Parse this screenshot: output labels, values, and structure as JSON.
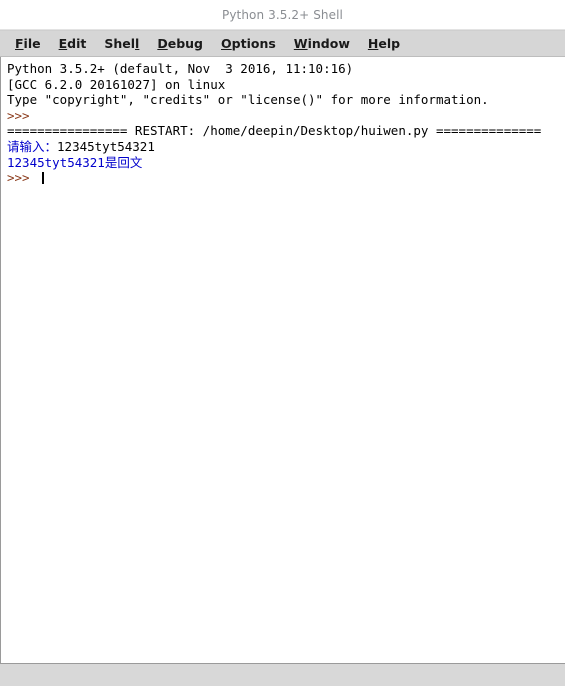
{
  "window": {
    "title": "Python 3.5.2+ Shell"
  },
  "menubar": {
    "items": [
      {
        "name": "file",
        "pre": "",
        "mnemonic": "F",
        "post": "ile"
      },
      {
        "name": "edit",
        "pre": "",
        "mnemonic": "E",
        "post": "dit"
      },
      {
        "name": "shell",
        "pre": "Shel",
        "mnemonic": "l",
        "post": ""
      },
      {
        "name": "debug",
        "pre": "",
        "mnemonic": "D",
        "post": "ebug"
      },
      {
        "name": "options",
        "pre": "",
        "mnemonic": "O",
        "post": "ptions"
      },
      {
        "name": "window",
        "pre": "",
        "mnemonic": "W",
        "post": "indow"
      },
      {
        "name": "help",
        "pre": "",
        "mnemonic": "H",
        "post": "elp"
      }
    ],
    "labels": {
      "file": "File",
      "edit": "Edit",
      "shell": "Shell",
      "debug": "Debug",
      "options": "Options",
      "window": "Window",
      "help": "Help"
    }
  },
  "shell": {
    "banner_line_1": "Python 3.5.2+ (default, Nov  3 2016, 11:10:16)",
    "banner_line_2": "[GCC 6.2.0 20161027] on linux",
    "banner_line_3": "Type \"copyright\", \"credits\" or \"license()\" for more information.",
    "prompt_1": ">>> ",
    "restart_line": "================ RESTART: /home/deepin/Desktop/huiwen.py ==============",
    "input_prompt": "请输入：",
    "input_value": "12345tyt54321",
    "result_line": "12345tyt54321是回文",
    "prompt_2": ">>> "
  },
  "colors": {
    "prompt": "#8b3a1a",
    "stdout": "#0000cc",
    "text": "#000000",
    "titlebar_bg": "#ffffff",
    "titlebar_fg": "#8a8d92",
    "menubar_bg": "#d6d6d6",
    "shell_bg": "#ffffff",
    "window_bg": "#d8d8d8"
  }
}
